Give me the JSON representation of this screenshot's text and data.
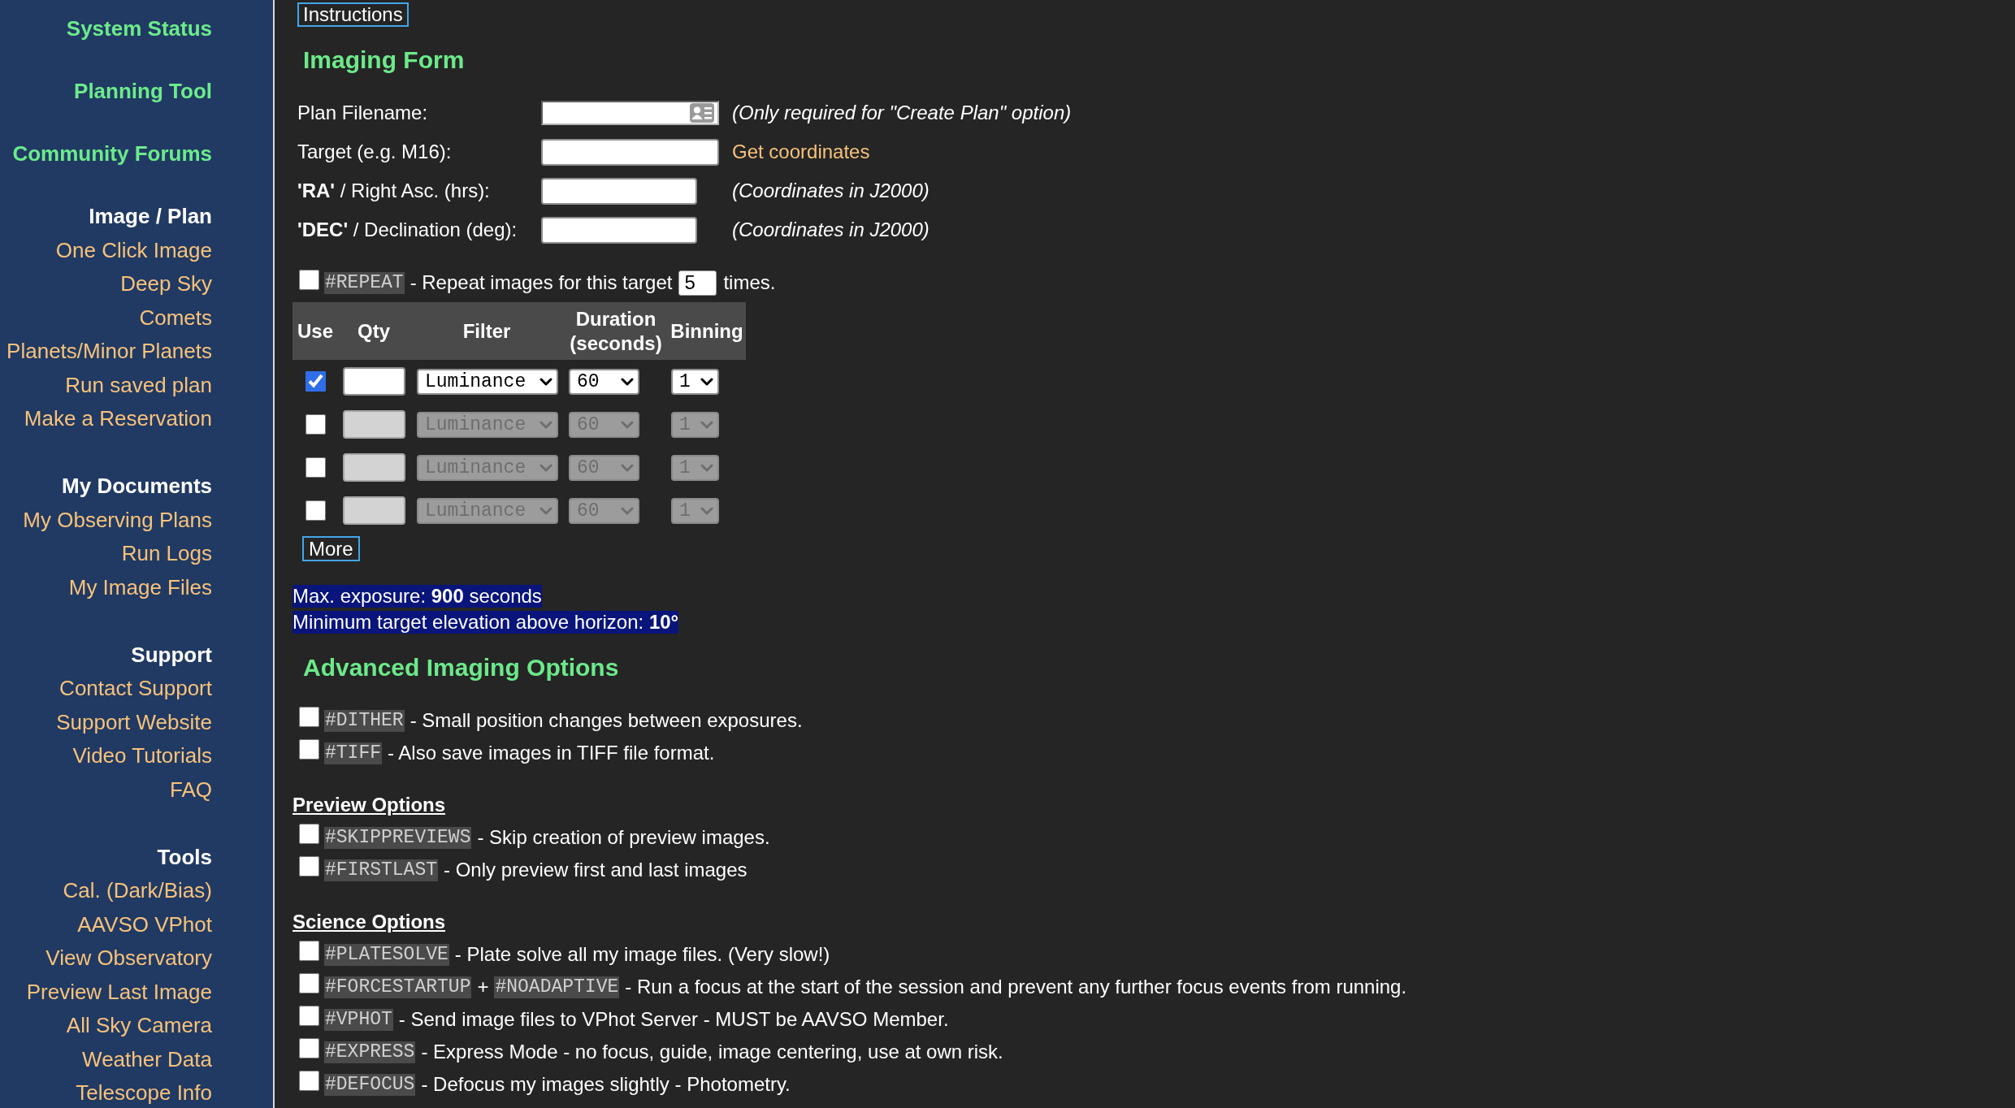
{
  "sidebar": {
    "top_links": [
      "System Status",
      "Planning Tool",
      "Community Forums"
    ],
    "sections": [
      {
        "heading": "Image / Plan",
        "items": [
          "One Click Image",
          "Deep Sky",
          "Comets",
          "Planets/Minor Planets",
          "Run saved plan",
          "Make a Reservation"
        ]
      },
      {
        "heading": "My Documents",
        "items": [
          "My Observing Plans",
          "Run Logs",
          "My Image Files"
        ]
      },
      {
        "heading": "Support",
        "items": [
          "Contact Support",
          "Support Website",
          "Video Tutorials",
          "FAQ"
        ]
      },
      {
        "heading": "Tools",
        "items": [
          "Cal. (Dark/Bias)",
          "AAVSO VPhot",
          "View Observatory",
          "Preview Last Image",
          "All Sky Camera",
          "Weather Data",
          "Telescope Info"
        ]
      }
    ]
  },
  "instructions_button": "Instructions",
  "imaging_form": {
    "title": "Imaging Form",
    "fields": [
      {
        "kind": "filename",
        "label": "Plan Filename:",
        "note": "(Only required for \"Create Plan\" option)"
      },
      {
        "kind": "target",
        "label": "Target (e.g. M16):",
        "link": "Get coordinates"
      },
      {
        "kind": "coordinate",
        "label": "**'RA'** / Right Asc. (hrs):",
        "note": "(Coordinates in J2000)"
      },
      {
        "kind": "coordinate",
        "label": "**'DEC'** / Declination (deg):",
        "note": "(Coordinates in J2000)"
      }
    ],
    "repeat": {
      "checked": false,
      "code": "#REPEAT",
      "text": "- Repeat images for this target",
      "value": "5",
      "suffix": "times."
    },
    "exposures": {
      "columns": [
        "Use",
        "Qty",
        "Filter",
        "Duration (seconds)",
        "Binning"
      ],
      "rows": [
        {
          "checked": true,
          "disabled": false,
          "filter": "Luminance",
          "duration": "60",
          "binning": "1"
        },
        {
          "checked": false,
          "disabled": true,
          "filter": "Luminance",
          "duration": "60",
          "binning": "1"
        },
        {
          "checked": false,
          "disabled": true,
          "filter": "Luminance",
          "duration": "60",
          "binning": "1"
        },
        {
          "checked": false,
          "disabled": true,
          "filter": "Luminance",
          "duration": "60",
          "binning": "1"
        }
      ],
      "more_button": "More"
    },
    "limits": [
      "Max. exposure: **900** seconds",
      "Minimum target elevation above horizon: **10°**"
    ]
  },
  "advanced_options": {
    "title": "Advanced Imaging Options",
    "groups": [
      {
        "options": [
          {
            "checked": false,
            "parts": [
              {
                "kind": "code",
                "text": "#DITHER"
              },
              {
                "kind": "text",
                "text": "- Small position changes between exposures."
              }
            ]
          },
          {
            "checked": false,
            "parts": [
              {
                "kind": "code",
                "text": "#TIFF"
              },
              {
                "kind": "text",
                "text": "- Also save images in TIFF file format."
              }
            ]
          }
        ]
      },
      {
        "heading": "Preview Options",
        "options": [
          {
            "checked": false,
            "parts": [
              {
                "kind": "code",
                "text": "#SKIPPREVIEWS"
              },
              {
                "kind": "text",
                "text": "- Skip creation of preview images."
              }
            ]
          },
          {
            "checked": false,
            "parts": [
              {
                "kind": "code",
                "text": "#FIRSTLAST"
              },
              {
                "kind": "text",
                "text": "- Only preview first and last images"
              }
            ]
          }
        ]
      },
      {
        "heading": "Science Options",
        "options": [
          {
            "checked": false,
            "parts": [
              {
                "kind": "code",
                "text": "#PLATESOLVE"
              },
              {
                "kind": "text",
                "text": "- Plate solve all my image files. (Very slow!)"
              }
            ]
          },
          {
            "checked": false,
            "parts": [
              {
                "kind": "code",
                "text": "#FORCESTARTUP"
              },
              {
                "kind": "text",
                "text": "+"
              },
              {
                "kind": "code",
                "text": "#NOADAPTIVE"
              },
              {
                "kind": "text",
                "text": "- Run a focus at the start of the session and prevent any further focus events from running."
              }
            ]
          },
          {
            "checked": false,
            "parts": [
              {
                "kind": "code",
                "text": "#VPHOT"
              },
              {
                "kind": "text",
                "text": "- Send image files to VPhot Server - MUST be AAVSO Member."
              }
            ]
          },
          {
            "checked": false,
            "parts": [
              {
                "kind": "code",
                "text": "#EXPRESS"
              },
              {
                "kind": "text",
                "text": "- Express Mode - no focus, guide, image centering, use at own risk."
              }
            ]
          },
          {
            "checked": false,
            "parts": [
              {
                "kind": "code",
                "text": "#DEFOCUS"
              },
              {
                "kind": "text",
                "text": "- Defocus my images slightly - Photometry."
              }
            ]
          }
        ]
      }
    ]
  }
}
